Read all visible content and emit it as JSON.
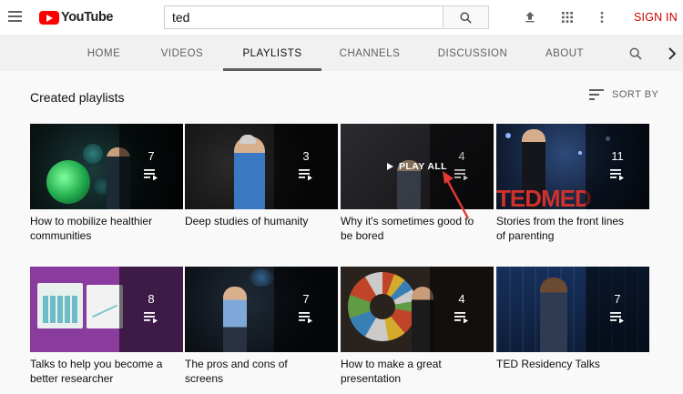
{
  "header": {
    "logo_text": "YouTube",
    "search_value": "ted",
    "sign_in": "SIGN IN"
  },
  "tabs": [
    {
      "label": "HOME"
    },
    {
      "label": "VIDEOS"
    },
    {
      "label": "PLAYLISTS"
    },
    {
      "label": "CHANNELS"
    },
    {
      "label": "DISCUSSION"
    },
    {
      "label": "ABOUT"
    }
  ],
  "section": {
    "title": "Created playlists",
    "sort_label": "SORT BY"
  },
  "play_all_label": "PLAY ALL",
  "playlists": [
    {
      "count": "7",
      "title": "How to mobilize healthier communities"
    },
    {
      "count": "3",
      "title": "Deep studies of humanity"
    },
    {
      "count": "4",
      "title": "Why it's sometimes good to be bored"
    },
    {
      "count": "11",
      "title": "Stories from the front lines of parenting"
    },
    {
      "count": "8",
      "title": "Talks to help you become a better researcher"
    },
    {
      "count": "7",
      "title": "The pros and cons of screens"
    },
    {
      "count": "4",
      "title": "How to make a great presentation"
    },
    {
      "count": "7",
      "title": "TED Residency Talks"
    }
  ],
  "thumbnail_words": {
    "tedmed": "TEDMED"
  },
  "colors": {
    "brand_red": "#ff0000",
    "sign_in_red": "#cc0000",
    "tab_indicator": "#606060"
  },
  "icons": [
    "menu-icon",
    "youtube-logo-icon",
    "search-icon",
    "upload-icon",
    "apps-icon",
    "more-vert-icon",
    "sort-icon",
    "chevron-right-icon",
    "playlist-icon",
    "play-icon"
  ]
}
